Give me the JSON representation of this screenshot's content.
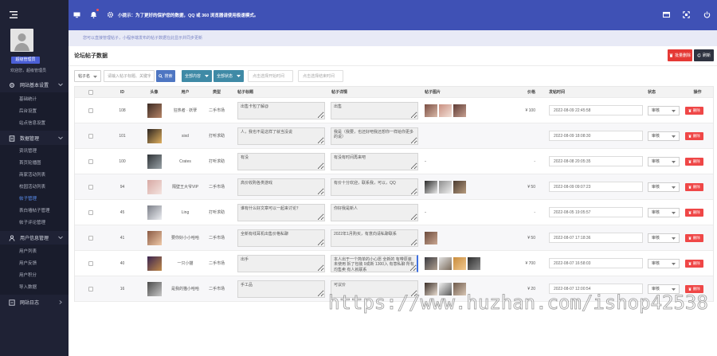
{
  "colors": {
    "header": "#3f51b5",
    "sidebar": "#1f2235",
    "active_menu": "#5b8ff0",
    "danger": "#e53935",
    "primary": "#4e76c2",
    "filter": "#3f8aa6"
  },
  "icons": {
    "menu": "menu-icon",
    "avatar": "user-silhouette-icon",
    "header_left": [
      "monitor-icon",
      "bell-icon",
      "settings-icon"
    ],
    "header_right": [
      "window-icon",
      "fullscreen-icon",
      "power-icon"
    ]
  },
  "sidebar": {
    "role_badge": "超级管理员",
    "welcome": "欢迎您，超级管理员",
    "groups": [
      {
        "icon": "gear-icon",
        "label": "网站基本设置",
        "items": [
          "基础统计",
          "后台设置",
          "站点信息设置"
        ]
      },
      {
        "icon": "document-icon",
        "label": "数据管理",
        "items": [
          "资讯管理",
          "首页轮播图",
          "商家活动列表",
          "校园活动列表",
          "帖子管理",
          "表白墙帖子管理",
          "帖子评论管理"
        ],
        "active": "帖子管理"
      },
      {
        "icon": "user-icon",
        "label": "用户信息管理",
        "items": [
          "用户列表",
          "用户反馈",
          "用户积分",
          "导入数据"
        ]
      },
      {
        "icon": "log-icon",
        "label": "网站日志",
        "items": []
      }
    ]
  },
  "header": {
    "notice": "小提示：为了更好的保护您的数据，QQ 或 360 浏览器请使用极速模式。"
  },
  "tip": "您可以直接管理帖子，小程序端发布的帖子数据在此显示并同步更新",
  "panel": {
    "title": "论坛帖子数据",
    "batch_delete": "批量删除",
    "refresh": "刷新"
  },
  "toolbar": {
    "field_select": "帖子名",
    "search_placeholder": "请输入帖子标题、关键字",
    "search_button": "搜索",
    "type_filter": "全部内容",
    "status_filter": "全部状态",
    "start_date_placeholder": "点击选择开始时间",
    "end_date_placeholder": "点击选择结束时间"
  },
  "table": {
    "columns": [
      "ID",
      "头像",
      "用户",
      "类型",
      "帖子标题",
      "帖子详情",
      "帖子图片",
      "价格",
      "发帖时间",
      "状态",
      "操作"
    ],
    "delete_label": "删除",
    "rows": [
      {
        "id": "108",
        "avatar": [
          "#3b2a24",
          "#b68466"
        ],
        "user": "狂热者 · 妖孽",
        "type": "二手市场",
        "title": "出售卡包了解@",
        "detail": "出售",
        "images": [
          [
            "#7a4e42",
            "#d9b8a8"
          ],
          [
            "#c98f80",
            "#f3e1d8"
          ],
          [
            "#5d3a33",
            "#c7a091"
          ]
        ],
        "images_empty_text": "",
        "price": "¥ 100",
        "time": "2022-08-09 22:45:58",
        "status": "审核"
      },
      {
        "id": "101",
        "avatar": [
          "#2c2420",
          "#e0b060"
        ],
        "user": "sixd",
        "type": "打听求助",
        "title": "人，我也不是这样了就当没说",
        "detail": "我是（我要，也还好吧我还想你一样给你更多的说）",
        "images": [],
        "images_empty_text": "",
        "price": "",
        "time": "2022-08-09 18:08:30",
        "status": "审核"
      },
      {
        "id": "100",
        "avatar": [
          "#2e3236",
          "#9aa3a8"
        ],
        "user": "Crates",
        "type": "打听求助",
        "title": "有没",
        "detail": "有没有时间再来吧",
        "images": [],
        "images_empty_text": "-",
        "price": "-",
        "time": "2022-08-08 20:05:35",
        "status": "审核"
      },
      {
        "id": "94",
        "avatar": [
          "#d7a9a4",
          "#f4e4e0"
        ],
        "user": "隔壁王大爷VIP",
        "type": "二手市场",
        "title": "高价收购各类游戏",
        "detail": "有价十分欢迎，联系我，可以，QQ",
        "images": [
          [
            "#2a2a2a",
            "#e9e9e9"
          ],
          [
            "#8e8e8e",
            "#efefef"
          ],
          [
            "#4a3b30",
            "#b79b7e"
          ]
        ],
        "images_empty_text": "",
        "price": "¥ 50",
        "time": "2022-08-09 09:07:23",
        "status": "审核"
      },
      {
        "id": "45",
        "avatar": [
          "#7c7f88",
          "#eceef2"
        ],
        "user": "Ling",
        "type": "打听求助",
        "title": "谁有什么好文章可以一起来讨论？",
        "detail": "你好我是新人",
        "images": [],
        "images_empty_text": "-",
        "price": "-",
        "time": "2022-08-05 19:05:57",
        "status": "审核"
      },
      {
        "id": "41",
        "avatar": [
          "#8a5a44",
          "#efc9a8"
        ],
        "user": "要你好小小哈哈",
        "type": "二手市场",
        "title": "全新有线耳机出售价格私聊",
        "detail": "2022年1月购买，有意向请私聊联系",
        "images": [
          [
            "#6b4a3c",
            "#caa792"
          ]
        ],
        "images_empty_text": "",
        "price": "¥ 50",
        "time": "2022-08-07 17:18:36",
        "status": "审核"
      },
      {
        "id": "40",
        "avatar": [
          "#3a2350",
          "#c08a4a"
        ],
        "user": "一只小猫",
        "type": "二手市场",
        "title": "出手",
        "detail": "本人出于一个简单的小心愿 全新的 有带原装 未使用 拆了包装 9成新 1300入 有意私聊 所有均售卖 有人就联系",
        "images": [
          [
            "#3a3a40",
            "#b0a090"
          ],
          [
            "#e2e2e2",
            "#7a6a5a"
          ],
          [
            "#c98c3c",
            "#f0c890"
          ],
          [
            "#2d2d2d",
            "#8c8c8c"
          ]
        ],
        "images_empty_text": "",
        "price": "¥ 700",
        "time": "2022-08-07 16:58:03",
        "status": "审核"
      },
      {
        "id": "16",
        "avatar": [
          "#4a4a4a",
          "#c8c8c8"
        ],
        "user": "是我的猫小哈哈",
        "type": "二手市场",
        "title": "手工品",
        "detail": "可议价",
        "images": [
          [
            "#3a2e28",
            "#e8dcd0"
          ],
          [
            "#f2f2f2",
            "#5a5a5a"
          ],
          [
            "#6e5a4c",
            "#d8c6b4"
          ]
        ],
        "images_empty_text": "",
        "price": "¥ 20",
        "time": "2022-08-07 12:00:54",
        "status": "审核"
      }
    ]
  },
  "watermark": "https://www.huzhan.com/ishop42538"
}
